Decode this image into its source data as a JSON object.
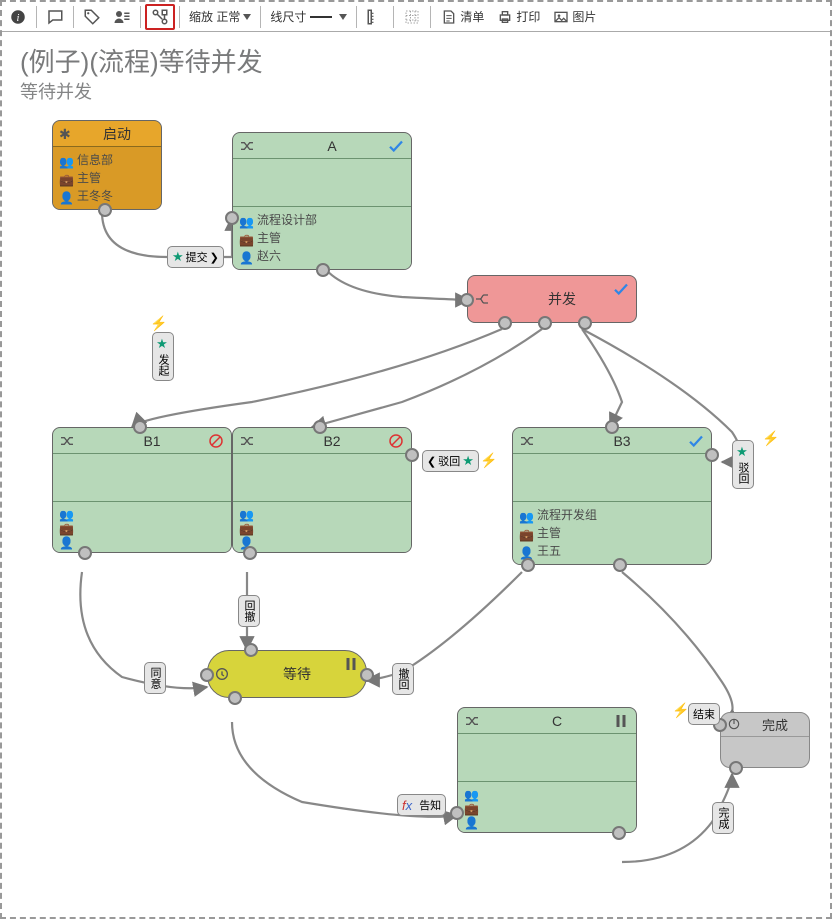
{
  "toolbar": {
    "zoom_label": "缩放",
    "zoom_value": "正常",
    "line_label": "线尺寸",
    "list_label": "清单",
    "print_label": "打印",
    "image_label": "图片"
  },
  "title": {
    "main": "(例子)(流程)等待并发",
    "sub": "等待并发"
  },
  "nodes": {
    "start": {
      "title": "启动",
      "rows": [
        "信息部",
        "主管",
        "王冬冬"
      ]
    },
    "a": {
      "title": "A",
      "rows": [
        "流程设计部",
        "主管",
        "赵六"
      ],
      "status": "check"
    },
    "fork": {
      "title": "并发",
      "status": "check"
    },
    "b1": {
      "title": "B1",
      "status": "forbid"
    },
    "b2": {
      "title": "B2",
      "status": "forbid"
    },
    "b3": {
      "title": "B3",
      "rows": [
        "流程开发组",
        "主管",
        "王五"
      ],
      "status": "check"
    },
    "wait": {
      "title": "等待",
      "status": "pause"
    },
    "c": {
      "title": "C",
      "status": "pause"
    },
    "done": {
      "title": "完成"
    }
  },
  "edges": {
    "start_a": "提交",
    "fork_b1": "发起",
    "fork_b2": "驳回",
    "fork_b3": "驳回",
    "b1_wait": "同意",
    "b2_wait": "回撤",
    "b3_wait": "撤回",
    "b3_done": "结束",
    "wait_c": "告知",
    "c_done": "完成"
  }
}
